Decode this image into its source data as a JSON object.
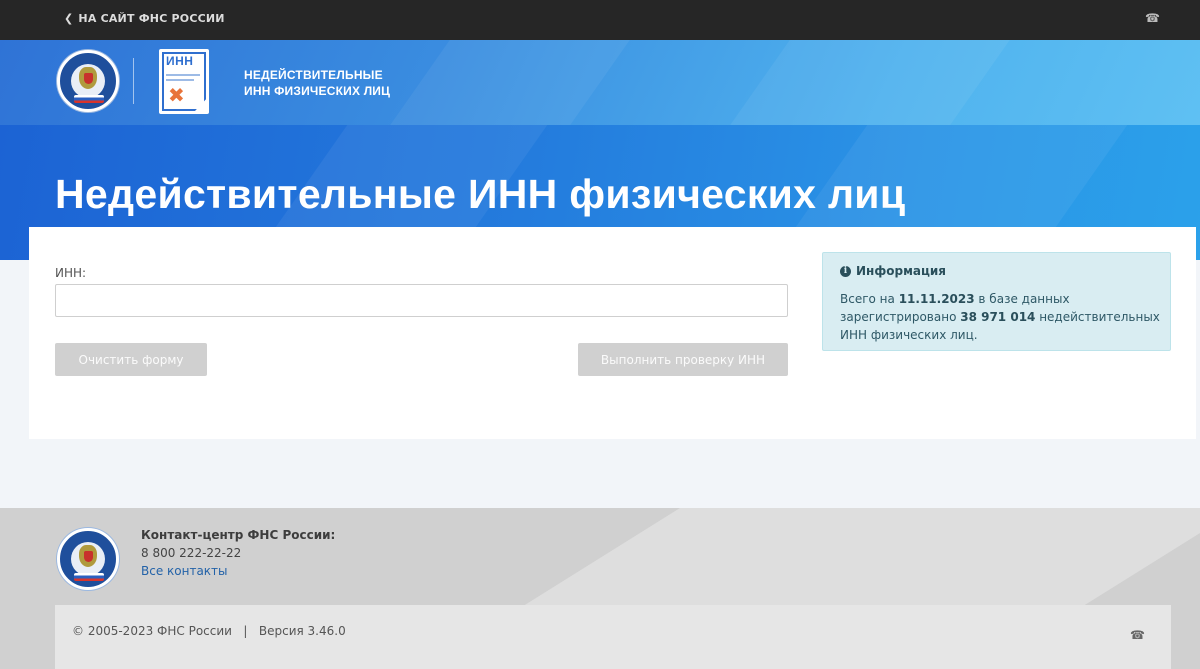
{
  "topbar": {
    "back_label": "НА САЙТ ФНС РОССИИ",
    "back_icon": "arrow-left-icon",
    "phone_icon": "phone-icon"
  },
  "header": {
    "app_name_line1": "НЕДЕЙСТВИТЕЛЬНЫЕ",
    "app_name_line2": "ИНН ФИЗИЧЕСКИХ ЛИЦ",
    "doc_label": "ИНН",
    "page_title": "Недействительные ИНН физических лиц"
  },
  "form": {
    "inn_label": "ИНН:",
    "inn_value": "",
    "clear_label": "Очистить форму",
    "check_label": "Выполнить проверку ИНН"
  },
  "info": {
    "title": "Информация",
    "text_prefix": "Всего на ",
    "date": "11.11.2023",
    "text_middle": " в базе данных зарегистрировано ",
    "count": "38 971 014",
    "text_suffix": " недействительных ИНН физических лиц."
  },
  "footer": {
    "contact_title": "Контакт-центр ФНС России:",
    "phone": "8 800 222-22-22",
    "contacts_link": "Все контакты",
    "copyright": "© 2005-2023 ФНС России   |   Версия 3.46.0"
  },
  "colors": {
    "topbar": "#262626",
    "hero_blue": "#2379dc",
    "button_disabled": "#d0d0d0",
    "info_bg": "#d9edf2",
    "link": "#2362a8"
  }
}
